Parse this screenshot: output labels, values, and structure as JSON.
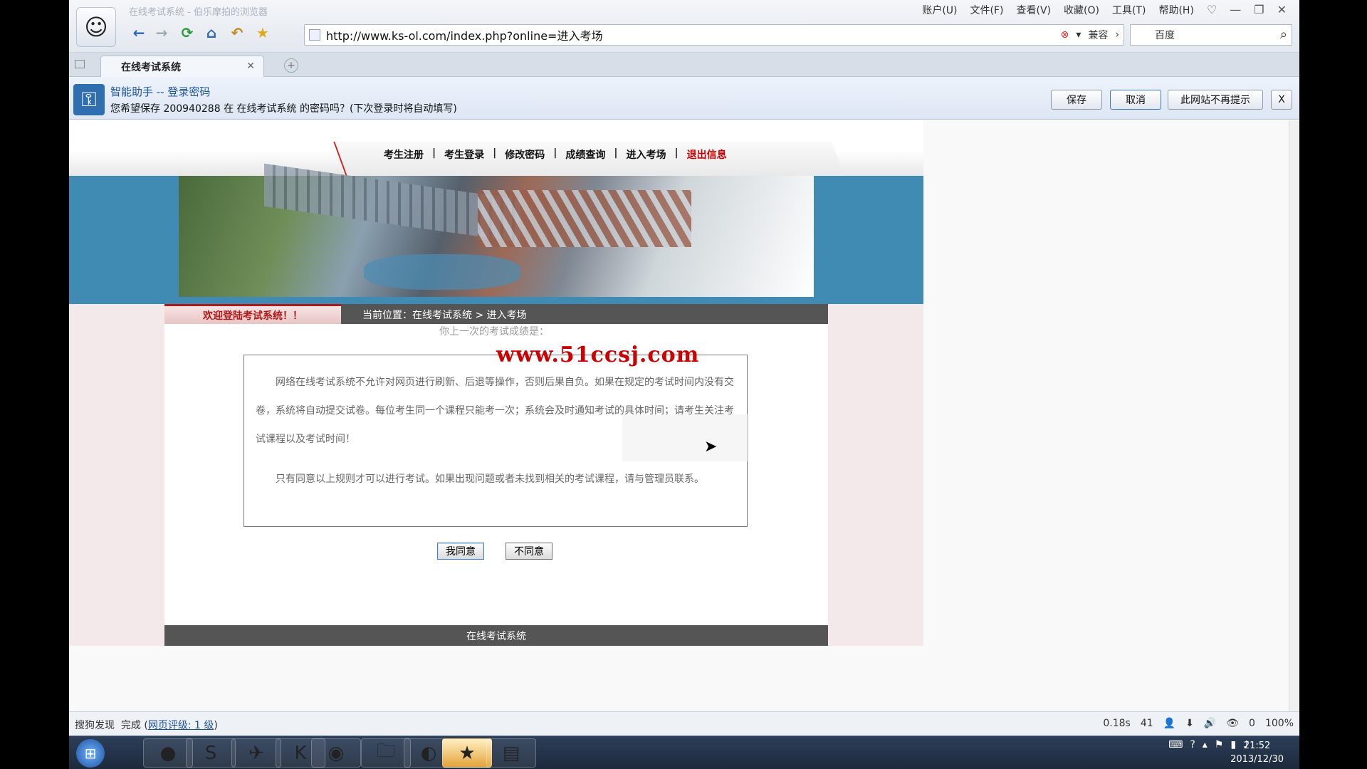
{
  "window": {
    "title": "在线考试系统 - 伯乐摩拍的浏览器"
  },
  "menu": [
    "账户(U)",
    "文件(F)",
    "查看(V)",
    "收藏(O)",
    "工具(T)",
    "帮助(H)"
  ],
  "address": {
    "url": "http://www.ks-ol.com/index.php?online=进入考场",
    "compat": "兼容"
  },
  "search": {
    "engine": "百度"
  },
  "tab": {
    "label": "在线考试系统"
  },
  "helper": {
    "title": "智能助手 -- 登录密码",
    "message": "您希望保存 200940288 在 在线考试系统 的密码吗？(下次登录时将自动填写)",
    "save": "保存",
    "cancel": "取消",
    "never": "此网站不再提示",
    "close": "X"
  },
  "nav": [
    "考生注册",
    "考生登录",
    "修改密码",
    "成绩查询",
    "进入考场",
    "退出信息"
  ],
  "page": {
    "welcome": "欢迎登陆考试系统！！",
    "breadcrumb": "当前位置：在线考试系统 > 进入考场",
    "last_score": "你上一次的考试成绩是：",
    "watermark": "www.51ccsj.com",
    "rule1": "网络在线考试系统不允许对网页进行刷新、后退等操作，否则后果自负。如果在规定的考试时间内没有交卷，系统将自动提交试卷。每位考生同一个课程只能考一次；系统会及时通知考试的具体时间；请考生关注考试课程以及考试时间！",
    "rule2": "只有同意以上规则才可以进行考试。如果出现问题或者未找到相关的考试课程，请与管理员联系。",
    "agree": "我同意",
    "disagree": "不同意",
    "footer": "在线考试系统"
  },
  "status": {
    "left": "搜狗发现",
    "done": "完成",
    "rating": "网页评级: 1 级",
    "time": "0.18s",
    "count": "41",
    "zero": "0",
    "zoom": "100%"
  },
  "clock": {
    "time": "21:52",
    "date": "2013/12/30"
  }
}
